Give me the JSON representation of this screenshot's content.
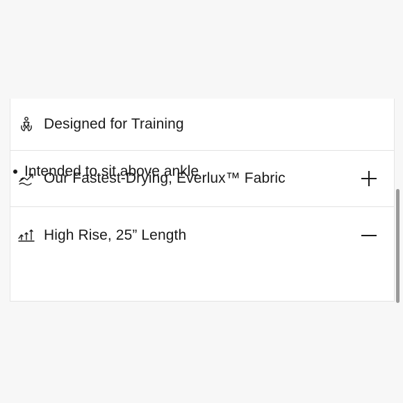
{
  "accordion": {
    "items": [
      {
        "label": "Designed for Training",
        "icon": "person-training-icon",
        "state": "static"
      },
      {
        "label": "Our Fastest-Drying, Everlux™ Fabric",
        "icon": "fast-drying-icon",
        "state": "collapsed",
        "toggle_icon": "plus-icon"
      },
      {
        "label": "High Rise, 25” Length",
        "icon": "rise-length-icon",
        "state": "expanded",
        "toggle_icon": "minus-icon",
        "details": [
          "Intended to sit above ankle"
        ]
      }
    ]
  },
  "colors": {
    "text": "#1a1a1a",
    "divider": "#e2e2e2",
    "panel": "#ffffff",
    "background": "#f7f7f7"
  }
}
